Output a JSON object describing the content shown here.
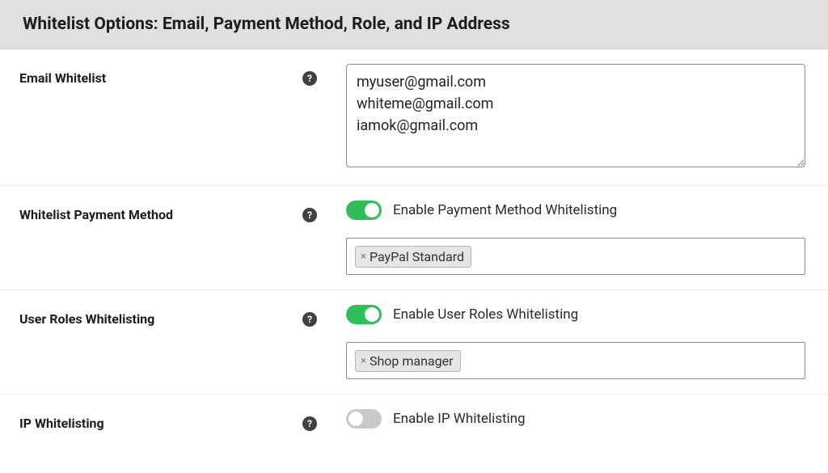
{
  "header": {
    "title": "Whitelist Options: Email, Payment Method, Role, and IP Address"
  },
  "help_icon_symbol": "?",
  "chip_remove_symbol": "×",
  "rows": {
    "email": {
      "label": "Email Whitelist",
      "value": "myuser@gmail.com\nwhiteme@gmail.com\niamok@gmail.com"
    },
    "payment": {
      "label": "Whitelist Payment Method",
      "toggle_label": "Enable Payment Method Whitelisting",
      "toggle_on": true,
      "chips": [
        "PayPal Standard"
      ]
    },
    "roles": {
      "label": "User Roles Whitelisting",
      "toggle_label": "Enable User Roles Whitelisting",
      "toggle_on": true,
      "chips": [
        "Shop manager"
      ]
    },
    "ip": {
      "label": "IP Whitelisting",
      "toggle_label": "Enable IP Whitelisting",
      "toggle_on": false
    }
  }
}
